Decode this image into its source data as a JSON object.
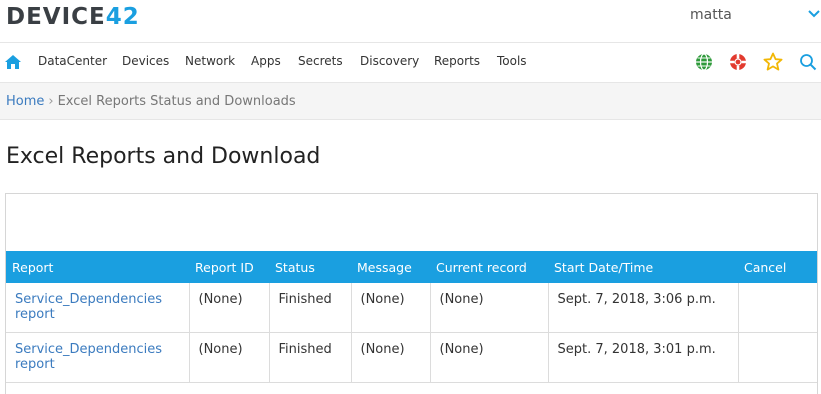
{
  "brand": {
    "logo_text": "DEVICE",
    "logo_num": "42"
  },
  "user": {
    "name": "matta"
  },
  "nav": {
    "items": [
      "DataCenter",
      "Devices",
      "Network",
      "Apps",
      "Secrets",
      "Discovery",
      "Reports",
      "Tools"
    ],
    "right_icons": [
      "globe-icon",
      "lifebuoy-icon",
      "star-icon",
      "search-icon"
    ]
  },
  "breadcrumb": {
    "home": "Home",
    "separator": "›",
    "current": "Excel Reports Status and Downloads"
  },
  "page": {
    "title": "Excel Reports and Download"
  },
  "table": {
    "columns": [
      "Report",
      "Report ID",
      "Status",
      "Message",
      "Current record",
      "Start Date/Time",
      "Cancel"
    ],
    "rows": [
      {
        "report": "Service_Dependencies report",
        "report_id": "(None)",
        "status": "Finished",
        "message": "(None)",
        "current_record": "(None)",
        "start": "Sept. 7, 2018, 3:06 p.m.",
        "cancel": ""
      },
      {
        "report": "Service_Dependencies report",
        "report_id": "(None)",
        "status": "Finished",
        "message": "(None)",
        "current_record": "(None)",
        "start": "Sept. 7, 2018, 3:01 p.m.",
        "cancel": ""
      }
    ]
  },
  "colors": {
    "accent": "#1a9fe0",
    "link": "#3b7bbf",
    "globe": "#2e9a3a",
    "lifebuoy": "#e23a2e",
    "star": "#f2b705",
    "search": "#1a9fe0"
  }
}
